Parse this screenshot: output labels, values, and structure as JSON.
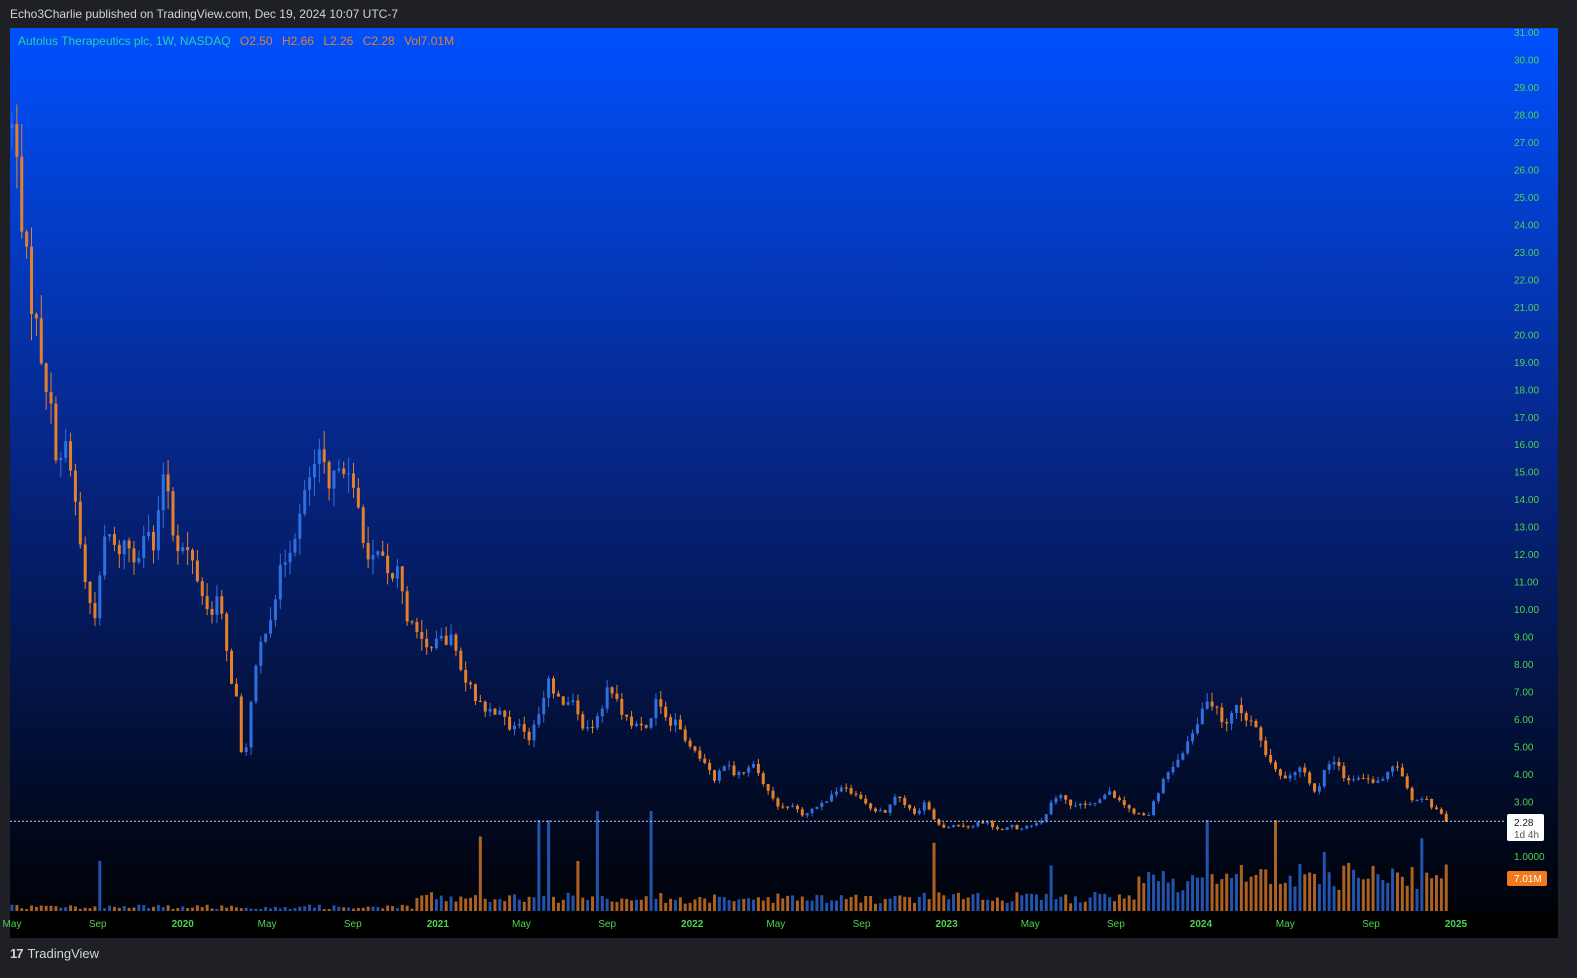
{
  "header": {
    "published": "Echo3Charlie published on TradingView.com, Dec 19, 2024 10:07 UTC-7"
  },
  "legend": {
    "symbol": "Autolus Therapeutics plc, 1W, NASDAQ",
    "open": "O2.50",
    "high": "H2.66",
    "low": "L2.26",
    "close": "C2.28",
    "volume": "Vol7.01M"
  },
  "price_tag": {
    "price": "2.28",
    "countdown": "1d 4h"
  },
  "volume_tag": "7.01M",
  "volume_axis_label": "1.0000",
  "footer": {
    "brand": "TradingView"
  },
  "colors": {
    "up": "#2f6fe0",
    "down": "#e5802a",
    "axis_text": "#4fd34f",
    "gradient_top": "#0050ff",
    "gradient_bottom": "#000000",
    "frame": "#1f2026"
  },
  "chart_data": {
    "type": "candlestick",
    "title": "Autolus Therapeutics plc, 1W, NASDAQ",
    "y_ticks": [
      "31.00",
      "30.00",
      "29.00",
      "28.00",
      "27.00",
      "26.00",
      "25.00",
      "24.00",
      "23.00",
      "22.00",
      "21.00",
      "20.00",
      "19.00",
      "18.00",
      "17.00",
      "16.00",
      "15.00",
      "14.00",
      "13.00",
      "12.00",
      "11.00",
      "10.00",
      "9.00",
      "8.00",
      "7.00",
      "6.00",
      "5.00",
      "4.00",
      "3.00"
    ],
    "ylim": [
      2.0,
      31.0
    ],
    "x_start": "2019-05-01",
    "x_end": "2024-12-19",
    "x_ticks": [
      {
        "label": "May",
        "date": "2019-05-01"
      },
      {
        "label": "Sep",
        "date": "2019-09-01"
      },
      {
        "label": "2020",
        "date": "2020-01-01"
      },
      {
        "label": "May",
        "date": "2020-05-01"
      },
      {
        "label": "Sep",
        "date": "2020-09-01"
      },
      {
        "label": "2021",
        "date": "2021-01-01"
      },
      {
        "label": "May",
        "date": "2021-05-01"
      },
      {
        "label": "Sep",
        "date": "2021-09-01"
      },
      {
        "label": "2022",
        "date": "2022-01-01"
      },
      {
        "label": "May",
        "date": "2022-05-01"
      },
      {
        "label": "Sep",
        "date": "2022-09-01"
      },
      {
        "label": "2023",
        "date": "2023-01-01"
      },
      {
        "label": "May",
        "date": "2023-05-01"
      },
      {
        "label": "Sep",
        "date": "2023-09-01"
      },
      {
        "label": "2024",
        "date": "2024-01-01"
      },
      {
        "label": "May",
        "date": "2024-05-01"
      },
      {
        "label": "Sep",
        "date": "2024-09-01"
      },
      {
        "label": "2025",
        "date": "2025-01-01"
      }
    ],
    "close_points": [
      [
        "2019-05-03",
        27.5
      ],
      [
        "2019-05-24",
        22.0
      ],
      [
        "2019-06-21",
        18.0
      ],
      [
        "2019-07-05",
        15.5
      ],
      [
        "2019-07-19",
        15.8
      ],
      [
        "2019-08-02",
        13.5
      ],
      [
        "2019-08-16",
        10.5
      ],
      [
        "2019-08-30",
        9.8
      ],
      [
        "2019-09-13",
        13.0
      ],
      [
        "2019-09-27",
        12.0
      ],
      [
        "2019-10-11",
        12.5
      ],
      [
        "2019-10-25",
        11.8
      ],
      [
        "2019-11-08",
        13.0
      ],
      [
        "2019-11-22",
        12.0
      ],
      [
        "2019-12-06",
        15.5
      ],
      [
        "2019-12-20",
        12.5
      ],
      [
        "2020-01-10",
        12.0
      ],
      [
        "2020-01-24",
        11.0
      ],
      [
        "2020-02-07",
        9.8
      ],
      [
        "2020-02-21",
        10.5
      ],
      [
        "2020-03-06",
        8.0
      ],
      [
        "2020-03-20",
        6.5
      ],
      [
        "2020-03-27",
        4.0
      ],
      [
        "2020-04-10",
        7.0
      ],
      [
        "2020-04-24",
        9.0
      ],
      [
        "2020-05-08",
        10.0
      ],
      [
        "2020-05-22",
        11.5
      ],
      [
        "2020-06-05",
        12.5
      ],
      [
        "2020-06-19",
        13.5
      ],
      [
        "2020-07-03",
        15.0
      ],
      [
        "2020-07-17",
        15.5
      ],
      [
        "2020-07-31",
        14.0
      ],
      [
        "2020-08-14",
        15.8
      ],
      [
        "2020-08-28",
        14.5
      ],
      [
        "2020-09-11",
        13.5
      ],
      [
        "2020-09-25",
        11.5
      ],
      [
        "2020-10-09",
        12.0
      ],
      [
        "2020-10-23",
        11.0
      ],
      [
        "2020-11-06",
        11.5
      ],
      [
        "2020-11-20",
        9.5
      ],
      [
        "2020-12-04",
        9.0
      ],
      [
        "2020-12-18",
        8.5
      ],
      [
        "2021-01-08",
        8.8
      ],
      [
        "2021-01-22",
        9.0
      ],
      [
        "2021-02-05",
        7.5
      ],
      [
        "2021-02-19",
        7.0
      ],
      [
        "2021-03-05",
        6.5
      ],
      [
        "2021-03-19",
        6.2
      ],
      [
        "2021-04-02",
        6.5
      ],
      [
        "2021-04-16",
        5.5
      ],
      [
        "2021-04-30",
        5.8
      ],
      [
        "2021-05-14",
        5.2
      ],
      [
        "2021-05-28",
        6.5
      ],
      [
        "2021-06-11",
        7.5
      ],
      [
        "2021-06-25",
        6.5
      ],
      [
        "2021-07-09",
        6.8
      ],
      [
        "2021-07-23",
        6.0
      ],
      [
        "2021-08-06",
        5.5
      ],
      [
        "2021-08-20",
        6.2
      ],
      [
        "2021-09-03",
        7.2
      ],
      [
        "2021-09-17",
        6.5
      ],
      [
        "2021-10-01",
        6.0
      ],
      [
        "2021-10-15",
        5.8
      ],
      [
        "2021-10-29",
        5.5
      ],
      [
        "2021-11-12",
        6.8
      ],
      [
        "2021-11-26",
        6.0
      ],
      [
        "2021-12-10",
        5.8
      ],
      [
        "2021-12-24",
        5.2
      ],
      [
        "2022-01-07",
        4.8
      ],
      [
        "2022-01-21",
        4.2
      ],
      [
        "2022-02-04",
        3.8
      ],
      [
        "2022-02-18",
        4.5
      ],
      [
        "2022-03-04",
        4.0
      ],
      [
        "2022-03-18",
        4.2
      ],
      [
        "2022-04-01",
        4.3
      ],
      [
        "2022-04-15",
        3.5
      ],
      [
        "2022-04-29",
        3.0
      ],
      [
        "2022-05-13",
        2.7
      ],
      [
        "2022-05-27",
        2.8
      ],
      [
        "2022-06-10",
        2.5
      ],
      [
        "2022-06-24",
        2.8
      ],
      [
        "2022-07-08",
        3.0
      ],
      [
        "2022-07-22",
        3.2
      ],
      [
        "2022-08-05",
        3.5
      ],
      [
        "2022-08-19",
        3.3
      ],
      [
        "2022-09-02",
        3.0
      ],
      [
        "2022-09-16",
        2.7
      ],
      [
        "2022-10-07",
        2.6
      ],
      [
        "2022-10-21",
        3.2
      ],
      [
        "2022-11-04",
        2.8
      ],
      [
        "2022-11-18",
        2.5
      ],
      [
        "2022-12-02",
        3.0
      ],
      [
        "2022-12-16",
        2.2
      ],
      [
        "2023-01-06",
        2.0
      ],
      [
        "2023-01-20",
        2.2
      ],
      [
        "2023-02-03",
        2.1
      ],
      [
        "2023-02-17",
        2.3
      ],
      [
        "2023-03-03",
        2.2
      ],
      [
        "2023-03-17",
        2.0
      ],
      [
        "2023-04-07",
        2.1
      ],
      [
        "2023-04-21",
        2.0
      ],
      [
        "2023-05-05",
        2.1
      ],
      [
        "2023-05-19",
        2.3
      ],
      [
        "2023-06-02",
        3.0
      ],
      [
        "2023-06-16",
        3.2
      ],
      [
        "2023-06-30",
        2.8
      ],
      [
        "2023-07-14",
        3.0
      ],
      [
        "2023-07-28",
        2.9
      ],
      [
        "2023-08-11",
        3.2
      ],
      [
        "2023-08-25",
        3.3
      ],
      [
        "2023-09-08",
        3.0
      ],
      [
        "2023-09-22",
        2.7
      ],
      [
        "2023-10-06",
        2.5
      ],
      [
        "2023-10-20",
        2.6
      ],
      [
        "2023-11-03",
        3.5
      ],
      [
        "2023-11-17",
        4.2
      ],
      [
        "2023-12-01",
        4.5
      ],
      [
        "2023-12-15",
        5.2
      ],
      [
        "2023-12-29",
        6.0
      ],
      [
        "2024-01-12",
        6.8
      ],
      [
        "2024-01-26",
        6.2
      ],
      [
        "2024-02-09",
        5.8
      ],
      [
        "2024-02-23",
        6.5
      ],
      [
        "2024-03-08",
        6.0
      ],
      [
        "2024-03-22",
        5.6
      ],
      [
        "2024-04-05",
        4.5
      ],
      [
        "2024-04-19",
        4.0
      ],
      [
        "2024-05-03",
        3.9
      ],
      [
        "2024-05-17",
        4.2
      ],
      [
        "2024-05-31",
        4.0
      ],
      [
        "2024-06-14",
        3.2
      ],
      [
        "2024-06-28",
        4.3
      ],
      [
        "2024-07-12",
        4.6
      ],
      [
        "2024-07-26",
        3.6
      ],
      [
        "2024-08-09",
        3.8
      ],
      [
        "2024-08-23",
        3.9
      ],
      [
        "2024-09-06",
        3.7
      ],
      [
        "2024-09-20",
        3.8
      ],
      [
        "2024-10-04",
        4.5
      ],
      [
        "2024-10-18",
        3.8
      ],
      [
        "2024-11-01",
        3.0
      ],
      [
        "2024-11-15",
        3.2
      ],
      [
        "2024-11-29",
        2.8
      ],
      [
        "2024-12-13",
        2.5
      ],
      [
        "2024-12-19",
        2.28
      ]
    ],
    "volume_spikes": [
      [
        "2019-09-06",
        0.55
      ],
      [
        "2020-12-18",
        0.1
      ],
      [
        "2021-03-05",
        0.82
      ],
      [
        "2021-05-28",
        1.0
      ],
      [
        "2021-06-11",
        1.0
      ],
      [
        "2021-07-23",
        0.55
      ],
      [
        "2021-08-20",
        1.1
      ],
      [
        "2021-11-05",
        2.5
      ],
      [
        "2022-12-16",
        0.75
      ],
      [
        "2023-06-02",
        0.5
      ],
      [
        "2024-01-12",
        1.0
      ],
      [
        "2024-04-19",
        1.0
      ],
      [
        "2024-06-28",
        0.65
      ],
      [
        "2024-11-15",
        0.8
      ],
      [
        "2024-12-19",
        0.4
      ]
    ]
  }
}
